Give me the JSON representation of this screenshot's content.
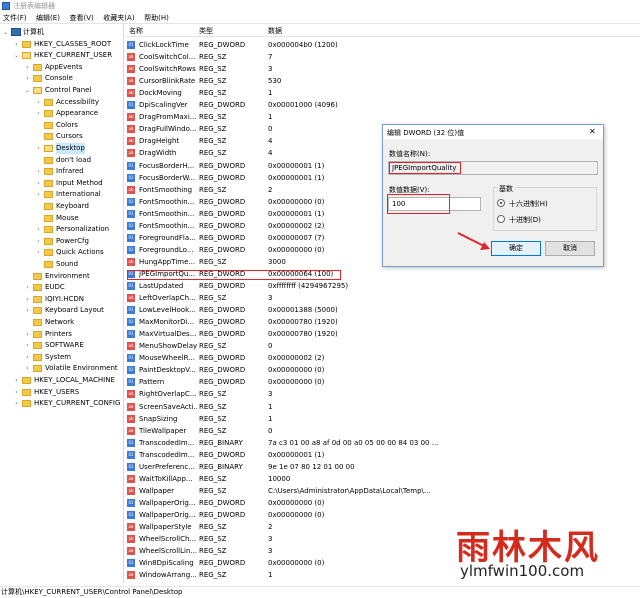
{
  "window": {
    "title": "注册表编辑器"
  },
  "menu": [
    "文件(F)",
    "编辑(E)",
    "查看(V)",
    "收藏夹(A)",
    "帮助(H)"
  ],
  "tree": [
    {
      "label": "计算机",
      "level": 0,
      "kind": "pc",
      "exp": "v"
    },
    {
      "label": "HKEY_CLASSES_ROOT",
      "level": 1,
      "exp": ">"
    },
    {
      "label": "HKEY_CURRENT_USER",
      "level": 1,
      "exp": "v",
      "open": true
    },
    {
      "label": "AppEvents",
      "level": 2,
      "exp": ">"
    },
    {
      "label": "Console",
      "level": 2,
      "exp": ">"
    },
    {
      "label": "Control Panel",
      "level": 2,
      "exp": "v",
      "open": true
    },
    {
      "label": "Accessibility",
      "level": 3,
      "exp": ">"
    },
    {
      "label": "Appearance",
      "level": 3,
      "exp": ">"
    },
    {
      "label": "Colors",
      "level": 3,
      "exp": ""
    },
    {
      "label": "Cursors",
      "level": 3,
      "exp": ""
    },
    {
      "label": "Desktop",
      "level": 3,
      "exp": ">",
      "selected": true
    },
    {
      "label": "don't load",
      "level": 3,
      "exp": ""
    },
    {
      "label": "Infrared",
      "level": 3,
      "exp": ">"
    },
    {
      "label": "Input Method",
      "level": 3,
      "exp": ">"
    },
    {
      "label": "International",
      "level": 3,
      "exp": ">"
    },
    {
      "label": "Keyboard",
      "level": 3,
      "exp": ""
    },
    {
      "label": "Mouse",
      "level": 3,
      "exp": ""
    },
    {
      "label": "Personalization",
      "level": 3,
      "exp": ">"
    },
    {
      "label": "PowerCfg",
      "level": 3,
      "exp": ">"
    },
    {
      "label": "Quick Actions",
      "level": 3,
      "exp": ">"
    },
    {
      "label": "Sound",
      "level": 3,
      "exp": ""
    },
    {
      "label": "Environment",
      "level": 2,
      "exp": ""
    },
    {
      "label": "EUDC",
      "level": 2,
      "exp": ">"
    },
    {
      "label": "IQIYI.HCDN",
      "level": 2,
      "exp": ">"
    },
    {
      "label": "Keyboard Layout",
      "level": 2,
      "exp": ">"
    },
    {
      "label": "Network",
      "level": 2,
      "exp": ""
    },
    {
      "label": "Printers",
      "level": 2,
      "exp": ">"
    },
    {
      "label": "SOFTWARE",
      "level": 2,
      "exp": ">"
    },
    {
      "label": "System",
      "level": 2,
      "exp": ">"
    },
    {
      "label": "Volatile Environment",
      "level": 2,
      "exp": ">"
    },
    {
      "label": "HKEY_LOCAL_MACHINE",
      "level": 1,
      "exp": ">"
    },
    {
      "label": "HKEY_USERS",
      "level": 1,
      "exp": ">"
    },
    {
      "label": "HKEY_CURRENT_CONFIG",
      "level": 1,
      "exp": ">"
    }
  ],
  "list": {
    "headers": {
      "name": "名称",
      "type": "类型",
      "data": "数据"
    },
    "rows": [
      {
        "icon": "dw",
        "name": "ClickLockTime",
        "type": "REG_DWORD",
        "data": "0x000004b0 (1200)"
      },
      {
        "icon": "sz",
        "name": "CoolSwitchCol...",
        "type": "REG_SZ",
        "data": "7"
      },
      {
        "icon": "sz",
        "name": "CoolSwitchRows",
        "type": "REG_SZ",
        "data": "3"
      },
      {
        "icon": "sz",
        "name": "CursorBlinkRate",
        "type": "REG_SZ",
        "data": "530"
      },
      {
        "icon": "sz",
        "name": "DockMoving",
        "type": "REG_SZ",
        "data": "1"
      },
      {
        "icon": "dw",
        "name": "DpiScalingVer",
        "type": "REG_DWORD",
        "data": "0x00001000 (4096)"
      },
      {
        "icon": "sz",
        "name": "DragFromMaxi...",
        "type": "REG_SZ",
        "data": "1"
      },
      {
        "icon": "sz",
        "name": "DragFullWindo...",
        "type": "REG_SZ",
        "data": "0"
      },
      {
        "icon": "sz",
        "name": "DragHeight",
        "type": "REG_SZ",
        "data": "4"
      },
      {
        "icon": "sz",
        "name": "DragWidth",
        "type": "REG_SZ",
        "data": "4"
      },
      {
        "icon": "dw",
        "name": "FocusBorderH...",
        "type": "REG_DWORD",
        "data": "0x00000001 (1)"
      },
      {
        "icon": "dw",
        "name": "FocusBorderW...",
        "type": "REG_DWORD",
        "data": "0x00000001 (1)"
      },
      {
        "icon": "sz",
        "name": "FontSmoothing",
        "type": "REG_SZ",
        "data": "2"
      },
      {
        "icon": "dw",
        "name": "FontSmoothin...",
        "type": "REG_DWORD",
        "data": "0x00000000 (0)"
      },
      {
        "icon": "dw",
        "name": "FontSmoothin...",
        "type": "REG_DWORD",
        "data": "0x00000001 (1)"
      },
      {
        "icon": "dw",
        "name": "FontSmoothin...",
        "type": "REG_DWORD",
        "data": "0x00000002 (2)"
      },
      {
        "icon": "dw",
        "name": "ForegroundFla...",
        "type": "REG_DWORD",
        "data": "0x00000007 (7)"
      },
      {
        "icon": "dw",
        "name": "ForegroundLo...",
        "type": "REG_DWORD",
        "data": "0x00000000 (0)"
      },
      {
        "icon": "sz",
        "name": "HungAppTime...",
        "type": "REG_SZ",
        "data": "3000"
      },
      {
        "icon": "dw",
        "name": "JPEGImportQu...",
        "type": "REG_DWORD",
        "data": "0x00000064 (100)",
        "selected": true
      },
      {
        "icon": "dw",
        "name": "LastUpdated",
        "type": "REG_DWORD",
        "data": "0xffffffff (4294967295)"
      },
      {
        "icon": "sz",
        "name": "LeftOverlapCh...",
        "type": "REG_SZ",
        "data": "3"
      },
      {
        "icon": "dw",
        "name": "LowLevelHook...",
        "type": "REG_DWORD",
        "data": "0x00001388 (5000)"
      },
      {
        "icon": "dw",
        "name": "MaxMonitorDi...",
        "type": "REG_DWORD",
        "data": "0x00000780 (1920)"
      },
      {
        "icon": "dw",
        "name": "MaxVirtualDes...",
        "type": "REG_DWORD",
        "data": "0x00000780 (1920)"
      },
      {
        "icon": "sz",
        "name": "MenuShowDelay",
        "type": "REG_SZ",
        "data": "0"
      },
      {
        "icon": "dw",
        "name": "MouseWheelR...",
        "type": "REG_DWORD",
        "data": "0x00000002 (2)"
      },
      {
        "icon": "dw",
        "name": "PaintDesktopV...",
        "type": "REG_DWORD",
        "data": "0x00000000 (0)"
      },
      {
        "icon": "dw",
        "name": "Pattern",
        "type": "REG_DWORD",
        "data": "0x00000000 (0)"
      },
      {
        "icon": "sz",
        "name": "RightOverlapC...",
        "type": "REG_SZ",
        "data": "3"
      },
      {
        "icon": "sz",
        "name": "ScreenSaveActi...",
        "type": "REG_SZ",
        "data": "1"
      },
      {
        "icon": "sz",
        "name": "SnapSizing",
        "type": "REG_SZ",
        "data": "1"
      },
      {
        "icon": "sz",
        "name": "TileWallpaper",
        "type": "REG_SZ",
        "data": "0"
      },
      {
        "icon": "bi",
        "name": "TranscodedIm...",
        "type": "REG_BINARY",
        "data": "7a c3 01 00 a8 af 0d 00 a0 05 00 00 84 03 00 ..."
      },
      {
        "icon": "dw",
        "name": "TranscodedIm...",
        "type": "REG_DWORD",
        "data": "0x00000001 (1)"
      },
      {
        "icon": "bi",
        "name": "UserPreferenc...",
        "type": "REG_BINARY",
        "data": "9e 1e 07 80 12 01 00 00"
      },
      {
        "icon": "sz",
        "name": "WaitToKillApp...",
        "type": "REG_SZ",
        "data": "10000"
      },
      {
        "icon": "sz",
        "name": "Wallpaper",
        "type": "REG_SZ",
        "data": "C:\\Users\\Administrator\\AppData\\Local\\Temp\\..."
      },
      {
        "icon": "dw",
        "name": "WallpaperOrig...",
        "type": "REG_DWORD",
        "data": "0x00000000 (0)"
      },
      {
        "icon": "dw",
        "name": "WallpaperOrig...",
        "type": "REG_DWORD",
        "data": "0x00000000 (0)"
      },
      {
        "icon": "sz",
        "name": "WallpaperStyle",
        "type": "REG_SZ",
        "data": "2"
      },
      {
        "icon": "sz",
        "name": "WheelScrollCh...",
        "type": "REG_SZ",
        "data": "3"
      },
      {
        "icon": "sz",
        "name": "WheelScrollLin...",
        "type": "REG_SZ",
        "data": "3"
      },
      {
        "icon": "dw",
        "name": "Win8DpiScaling",
        "type": "REG_DWORD",
        "data": "0x00000000 (0)"
      },
      {
        "icon": "sz",
        "name": "WindowArrang...",
        "type": "REG_SZ",
        "data": "1"
      }
    ]
  },
  "status": {
    "path": "计算机\\HKEY_CURRENT_USER\\Control Panel\\Desktop"
  },
  "dialog": {
    "title": "编辑 DWORD (32 位)值",
    "name_label": "数值名称(N):",
    "name_value": "JPEGImportQuality",
    "data_label": "数值数据(V):",
    "data_value": "100",
    "base_label": "基数",
    "hex_label": "十六进制(H)",
    "dec_label": "十进制(D)",
    "base_selected": "hex",
    "ok_label": "确定",
    "cancel_label": "取消"
  },
  "watermark": {
    "cn": "雨林木风",
    "en": "ylmfwin100.com"
  },
  "colors": {
    "highlight_red": "#e0242b",
    "selection": "#cce8ff",
    "watermark_red": "#d52b1e"
  }
}
